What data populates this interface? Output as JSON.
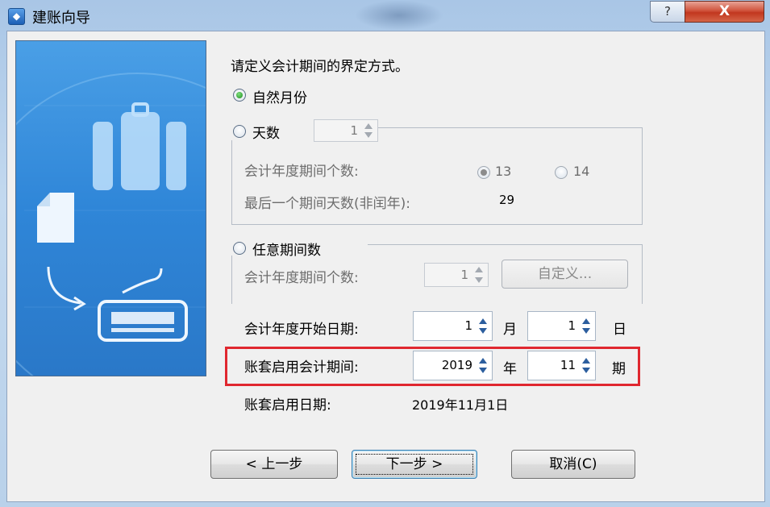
{
  "window": {
    "title": "建账向导",
    "help_glyph": "?",
    "close_glyph": "X"
  },
  "prompt": "请定义会计期间的界定方式。",
  "options": {
    "natural_month": {
      "label": "自然月份",
      "selected": true
    },
    "days": {
      "label": "天数",
      "selected": false,
      "days_value": "1",
      "period_count_label": "会计年度期间个数:",
      "period_13": "13",
      "period_14": "14",
      "last_days_label": "最后一个期间天数(非闰年):",
      "last_days_value": "29"
    },
    "arbitrary": {
      "label": "任意期间数",
      "selected": false,
      "period_count_label": "会计年度期间个数:",
      "period_count_value": "1",
      "custom_button": "自定义..."
    }
  },
  "start_date": {
    "label": "会计年度开始日期:",
    "month_value": "1",
    "month_unit": "月",
    "day_value": "1",
    "day_unit": "日"
  },
  "enable_period": {
    "label": "账套启用会计期间:",
    "year_value": "2019",
    "year_unit": "年",
    "period_value": "11",
    "period_unit": "期"
  },
  "enable_date": {
    "label": "账套启用日期:",
    "value": "2019年11月1日"
  },
  "buttons": {
    "prev": "< 上一步",
    "next": "下一步 >",
    "cancel": "取消(C)"
  },
  "colors": {
    "highlight": "#e0272f",
    "banner": "#2f86d8"
  }
}
